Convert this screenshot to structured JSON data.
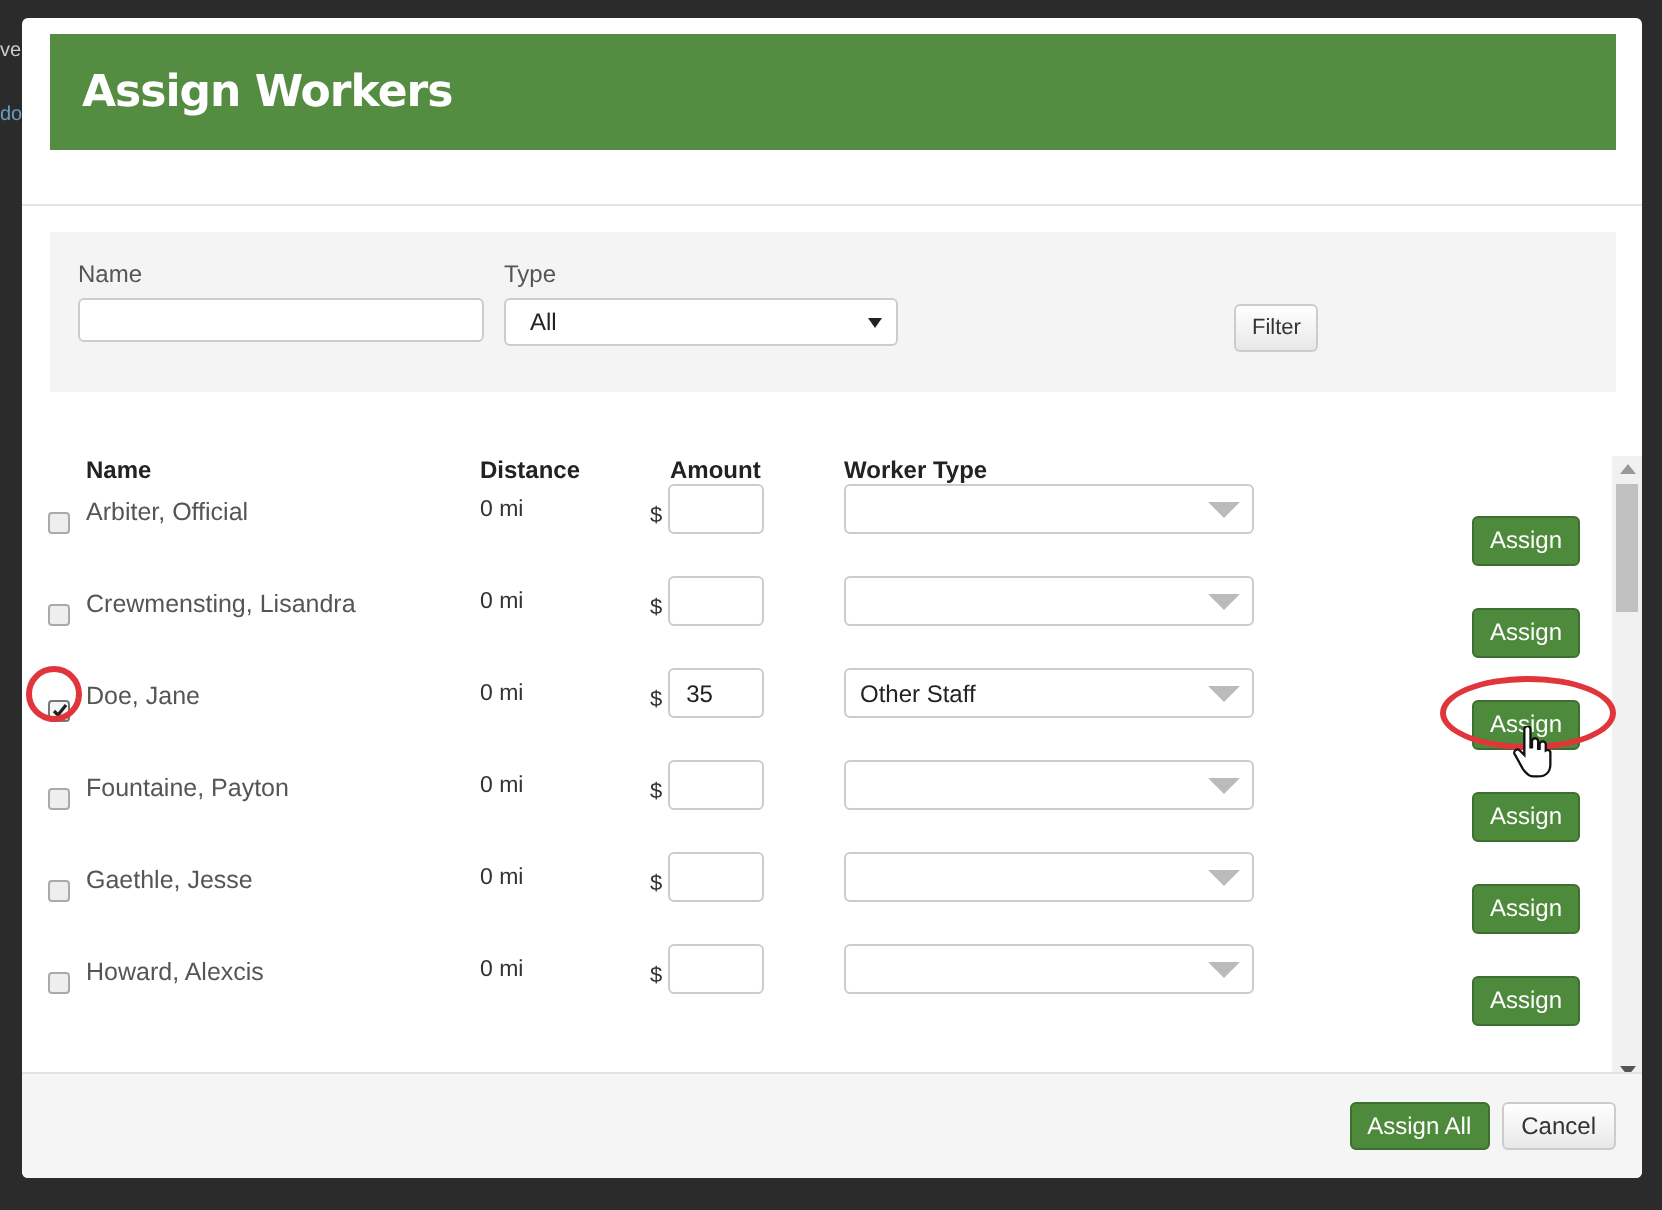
{
  "background": {
    "texts": [
      "ve",
      "do"
    ]
  },
  "dialog": {
    "title": "Assign Workers",
    "filter": {
      "name_label": "Name",
      "type_label": "Type",
      "type_value": "All",
      "filter_button": "Filter"
    },
    "columns": [
      "Name",
      "Distance",
      "Amount",
      "Worker Type"
    ],
    "rows": [
      {
        "name": "Arbiter, Official",
        "distance": "0 mi",
        "currency": "$",
        "amount": "",
        "worker_type": "",
        "checked": false,
        "button": "Assign",
        "circled": false
      },
      {
        "name": "Crewmensting, Lisandra",
        "distance": "0 mi",
        "currency": "$",
        "amount": "",
        "worker_type": "",
        "checked": false,
        "button": "Assign",
        "circled": false
      },
      {
        "name": "Doe, Jane",
        "distance": "0 mi",
        "currency": "$",
        "amount": "35",
        "worker_type": "Other Staff",
        "checked": true,
        "button": "Assign",
        "circled": true
      },
      {
        "name": "Fountaine, Payton",
        "distance": "0 mi",
        "currency": "$",
        "amount": "",
        "worker_type": "",
        "checked": false,
        "button": "Assign",
        "circled": false
      },
      {
        "name": "Gaethle, Jesse",
        "distance": "0 mi",
        "currency": "$",
        "amount": "",
        "worker_type": "",
        "checked": false,
        "button": "Assign",
        "circled": false
      },
      {
        "name": "Howard, Alexcis",
        "distance": "0 mi",
        "currency": "$",
        "amount": "",
        "worker_type": "",
        "checked": false,
        "button": "Assign",
        "circled": false
      }
    ],
    "footer": {
      "primary": "Assign All",
      "secondary": "Cancel"
    }
  }
}
